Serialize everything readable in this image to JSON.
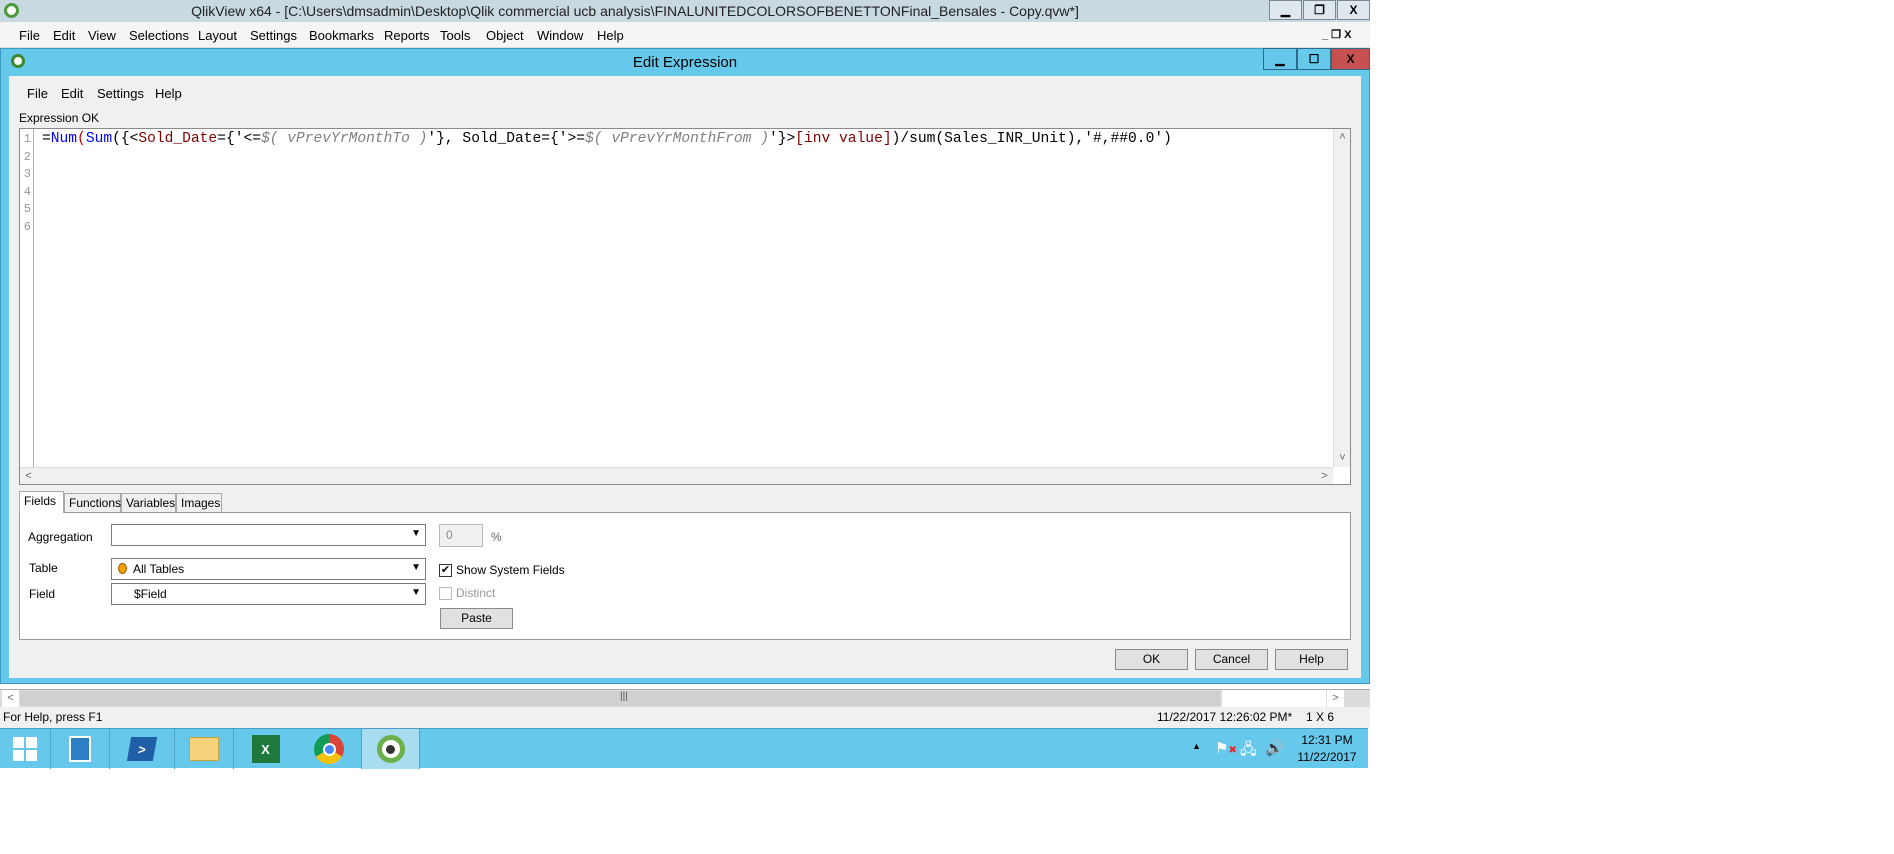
{
  "app": {
    "title": "QlikView x64 - [C:\\Users\\dmsadmin\\Desktop\\Qlik commercial ucb analysis\\FINALUNITEDCOLORSOFBENETTONFinal_Bensales - Copy.qvw*]",
    "menu": [
      "File",
      "Edit",
      "View",
      "Selections",
      "Layout",
      "Settings",
      "Bookmarks",
      "Reports",
      "Tools",
      "Object",
      "Window",
      "Help"
    ]
  },
  "dialog": {
    "title": "Edit Expression",
    "menu": [
      "File",
      "Edit",
      "Settings",
      "Help"
    ],
    "status": "Expression OK",
    "line_numbers": [
      "1",
      "2",
      "3",
      "4",
      "5",
      "6"
    ],
    "code": [
      {
        "text": "=",
        "color": "#000000"
      },
      {
        "text": "Num",
        "color": "#0000ff"
      },
      {
        "text": "(",
        "color": "#cc0000"
      },
      {
        "text": "Sum",
        "color": "#0000ff"
      },
      {
        "text": "({<",
        "color": "#000000"
      },
      {
        "text": "Sold_Date",
        "color": "#800000"
      },
      {
        "text": "={'<=",
        "color": "#000000"
      },
      {
        "text": "$( vPrevYrMonthTo )",
        "color": "#808080",
        "italic": true
      },
      {
        "text": "'}, Sold_Date={'>=",
        "color": "#000000"
      },
      {
        "text": "$( vPrevYrMonthFrom )",
        "color": "#808080",
        "italic": true
      },
      {
        "text": "'}>",
        "color": "#000000"
      },
      {
        "text": "[inv value]",
        "color": "#800000"
      },
      {
        "text": ")/sum(Sales_INR_Unit),'#,##0.0')",
        "color": "#000000"
      }
    ],
    "tabs": [
      "Fields",
      "Functions",
      "Variables",
      "Images"
    ],
    "fields": {
      "aggregation_label": "Aggregation",
      "aggregation_value": "",
      "percent_value": "0",
      "percent_sign": "%",
      "table_label": "Table",
      "table_value": "All Tables",
      "field_label": "Field",
      "field_value": "$Field",
      "show_system_fields": "Show System Fields",
      "show_system_fields_checked": true,
      "distinct": "Distinct",
      "distinct_checked": false,
      "paste": "Paste"
    },
    "buttons": {
      "ok": "OK",
      "cancel": "Cancel",
      "help": "Help"
    }
  },
  "statusbar": {
    "help": "For Help, press F1",
    "timestamp": "11/22/2017 12:26:02 PM*",
    "grid": "1 X 6"
  },
  "taskbar": {
    "time": "12:31 PM",
    "date": "11/22/2017"
  }
}
